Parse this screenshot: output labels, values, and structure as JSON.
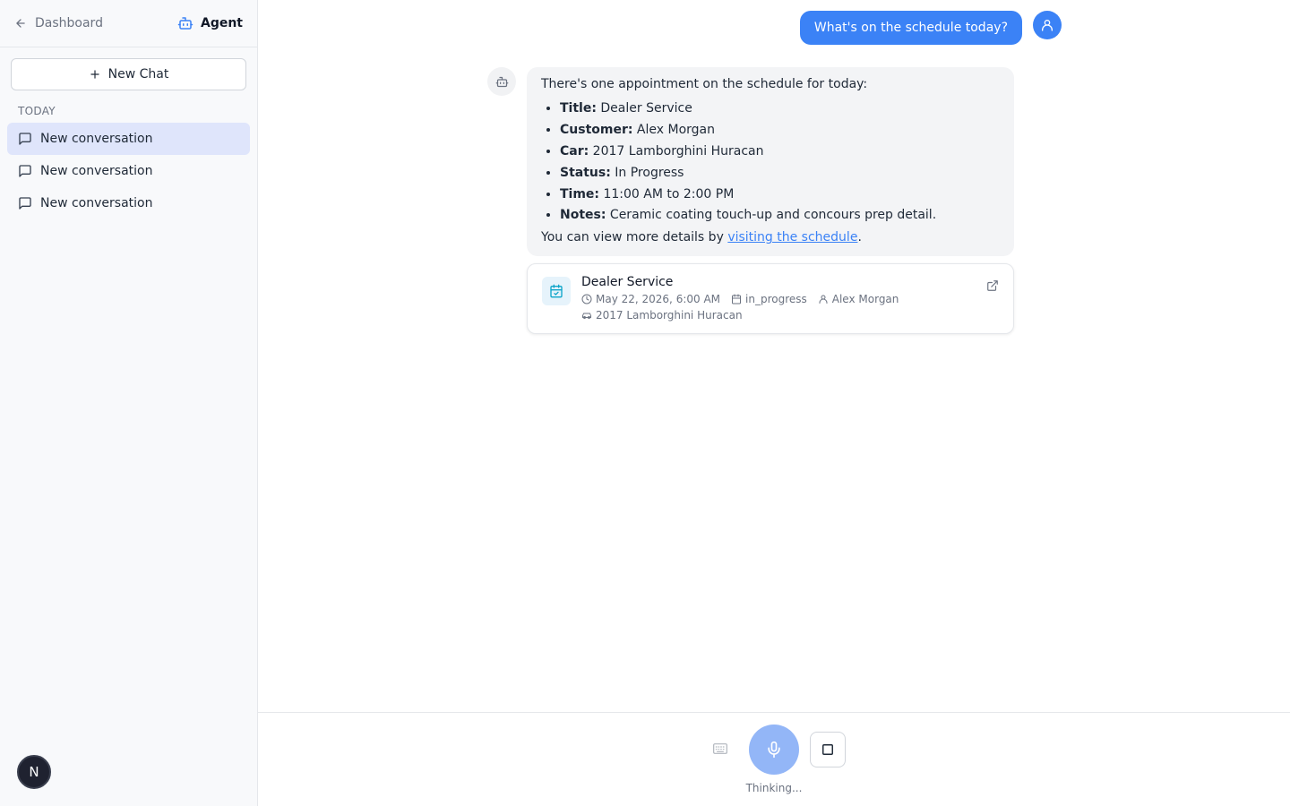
{
  "sidebar": {
    "back_label": "Dashboard",
    "agent_label": "Agent",
    "new_chat_label": "New Chat",
    "section_label": "TODAY",
    "conversations": [
      {
        "label": "New conversation",
        "active": true
      },
      {
        "label": "New conversation",
        "active": false
      },
      {
        "label": "New conversation",
        "active": false
      }
    ],
    "user_initial": "N"
  },
  "chat": {
    "user_message": "What's on the schedule today?",
    "bot_intro": "There's one appointment on the schedule for today:",
    "bot_items": [
      {
        "key": "Title:",
        "value": " Dealer Service"
      },
      {
        "key": "Customer:",
        "value": " Alex Morgan"
      },
      {
        "key": "Car:",
        "value": " 2017 Lamborghini Huracan"
      },
      {
        "key": "Status:",
        "value": " In Progress"
      },
      {
        "key": "Time:",
        "value": " 11:00 AM to 2:00 PM"
      },
      {
        "key": "Notes:",
        "value": " Ceramic coating touch-up and concours prep detail."
      }
    ],
    "bot_outro_prefix": "You can view more details by ",
    "bot_link_text": "visiting the schedule",
    "bot_outro_suffix": "."
  },
  "appointment_card": {
    "title": "Dealer Service",
    "datetime": "May 22, 2026, 6:00 AM",
    "status": "in_progress",
    "customer": "Alex Morgan",
    "car": "2017 Lamborghini Huracan"
  },
  "input_bar": {
    "status_text": "Thinking..."
  },
  "colors": {
    "accent": "#3b82f6",
    "mic_active": "#93b6f7",
    "active_item_bg": "#dfe5fb"
  }
}
